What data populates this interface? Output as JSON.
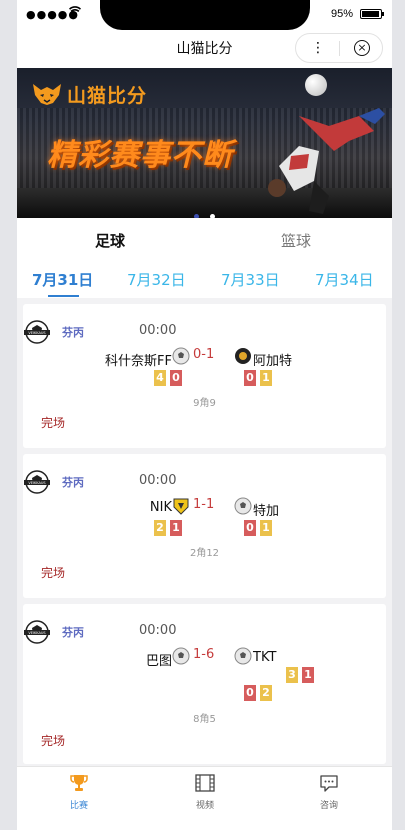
{
  "status_bar": {
    "signal": "●●●●●",
    "battery_percent": "95%",
    "battery_level": 0.95
  },
  "nav": {
    "title": "山猫比分",
    "more_icon": "more-dots-icon",
    "close_icon": "close-circle-icon"
  },
  "banner": {
    "brand": "山猫比分",
    "slogan": "精彩赛事不断",
    "slides": 2,
    "active_slide": 1
  },
  "sport_tabs": [
    {
      "label": "足球",
      "active": true
    },
    {
      "label": "篮球",
      "active": false
    }
  ],
  "date_tabs": [
    {
      "label": "7月31日",
      "active": true
    },
    {
      "label": "7月32日",
      "active": false
    },
    {
      "label": "7月33日",
      "active": false
    },
    {
      "label": "7月34日",
      "active": false
    }
  ],
  "matches": [
    {
      "league": "芬丙",
      "time": "00:00",
      "home": "科什奈斯FF",
      "away": "阿加特",
      "score": "0-1",
      "home_stats": [
        "4",
        "0"
      ],
      "away_stats": [
        "0",
        "1"
      ],
      "corners": "9角9",
      "status": "完场"
    },
    {
      "league": "芬丙",
      "time": "00:00",
      "home": "NIK",
      "away": "特加",
      "score": "1-1",
      "home_stats": [
        "2",
        "1"
      ],
      "away_stats": [
        "0",
        "1"
      ],
      "corners": "2角12",
      "status": "完场"
    },
    {
      "league": "芬丙",
      "time": "00:00",
      "home": "巴图",
      "away": "TKT",
      "score": "1-6",
      "home_stats": [],
      "away_stats": [
        "3",
        "1"
      ],
      "away_stats_2": [
        "0",
        "2"
      ],
      "corners": "8角5",
      "status": "完场"
    }
  ],
  "tabbar": [
    {
      "label": "比赛",
      "icon": "trophy-icon",
      "active": true
    },
    {
      "label": "视频",
      "icon": "film-icon",
      "active": false
    },
    {
      "label": "咨询",
      "icon": "message-icon",
      "active": false
    }
  ],
  "colors": {
    "accent_blue": "#2f7fd1",
    "date_blue": "#3ab6e8",
    "score_red": "#c53b3b",
    "brand_orange": "#f39a1e",
    "pill_yellow": "#ebc14c",
    "pill_red": "#d65c5c"
  }
}
